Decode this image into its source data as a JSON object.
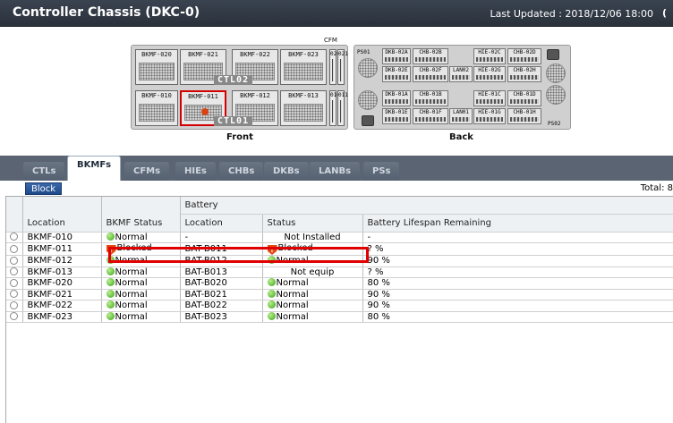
{
  "header": {
    "title": "Controller Chassis (DKC-0)",
    "last_updated": "Last Updated : 2018/12/06 18:00",
    "edge_glyph": "("
  },
  "chassis": {
    "front_caption": "Front",
    "back_caption": "Back",
    "cfm_title": "CFM",
    "ctl_top": "CTL02",
    "ctl_bottom": "CTL01",
    "front_top_slots": [
      "BKMF-020",
      "BKMF-021",
      "BKMF-022",
      "BKMF-023"
    ],
    "front_bottom_slots": [
      "BKMF-010",
      "BKMF-011",
      "BKMF-012",
      "BKMF-013"
    ],
    "cfm_top": [
      "020",
      "021"
    ],
    "cfm_bottom": [
      "010",
      "011"
    ],
    "back_row1": [
      "DKB-02A",
      "CHB-02B",
      "HIE-02C",
      "CHB-02D"
    ],
    "back_row2": [
      "DKB-02E",
      "CHB-02F",
      "LAN02",
      "HIE-02G",
      "CHB-02H"
    ],
    "back_row3": [
      "DKB-01A",
      "CHB-01B",
      "HIE-01C",
      "CHB-01D"
    ],
    "back_row4": [
      "DKB-01E",
      "CHB-01F",
      "LAN01",
      "HIE-01G",
      "CHB-01H"
    ],
    "ps_top": "PS01",
    "ps_bottom": "PS02"
  },
  "tabs": [
    {
      "label": "CTLs",
      "active": false
    },
    {
      "label": "BKMFs",
      "active": true
    },
    {
      "label": "CFMs",
      "active": false
    },
    {
      "label": "HIEs",
      "active": false
    },
    {
      "label": "CHBs",
      "active": false
    },
    {
      "label": "DKBs",
      "active": false
    },
    {
      "label": "LANBs",
      "active": false
    },
    {
      "label": "PSs",
      "active": false
    }
  ],
  "toolbar": {
    "block_label": "Block",
    "total": "Total: 8"
  },
  "table": {
    "group_header": "Battery",
    "columns": {
      "location": "Location",
      "bkmf_status": "BKMF Status",
      "battery_location": "Location",
      "battery_status": "Status",
      "lifespan": "Battery Lifespan Remaining"
    },
    "rows": [
      {
        "location": "BKMF-010",
        "status": "Normal",
        "status_kind": "ok",
        "bat_location": "-",
        "bat_status": "Not Installed",
        "bat_kind": "none",
        "lifespan": "-"
      },
      {
        "location": "BKMF-011",
        "status": "Blocked",
        "status_kind": "bad",
        "bat_location": "BAT-B011",
        "bat_status": "Blocked",
        "bat_kind": "bad",
        "lifespan": "? %"
      },
      {
        "location": "BKMF-012",
        "status": "Normal",
        "status_kind": "ok",
        "bat_location": "BAT-B012",
        "bat_status": "Normal",
        "bat_kind": "ok",
        "lifespan": "90 %"
      },
      {
        "location": "BKMF-013",
        "status": "Normal",
        "status_kind": "ok",
        "bat_location": "BAT-B013",
        "bat_status": "Not equip",
        "bat_kind": "none",
        "lifespan": "? %"
      },
      {
        "location": "BKMF-020",
        "status": "Normal",
        "status_kind": "ok",
        "bat_location": "BAT-B020",
        "bat_status": "Normal",
        "bat_kind": "ok",
        "lifespan": "80 %"
      },
      {
        "location": "BKMF-021",
        "status": "Normal",
        "status_kind": "ok",
        "bat_location": "BAT-B021",
        "bat_status": "Normal",
        "bat_kind": "ok",
        "lifespan": "90 %"
      },
      {
        "location": "BKMF-022",
        "status": "Normal",
        "status_kind": "ok",
        "bat_location": "BAT-B022",
        "bat_status": "Normal",
        "bat_kind": "ok",
        "lifespan": "90 %"
      },
      {
        "location": "BKMF-023",
        "status": "Normal",
        "status_kind": "ok",
        "bat_location": "BAT-B023",
        "bat_status": "Normal",
        "bat_kind": "ok",
        "lifespan": "80 %"
      }
    ]
  },
  "colors": {
    "header_bg": "#2f3641",
    "tabbar_bg": "#5a6472",
    "highlight": "#e00000",
    "ok": "#3aa21a",
    "blocked": "#e24a12"
  }
}
